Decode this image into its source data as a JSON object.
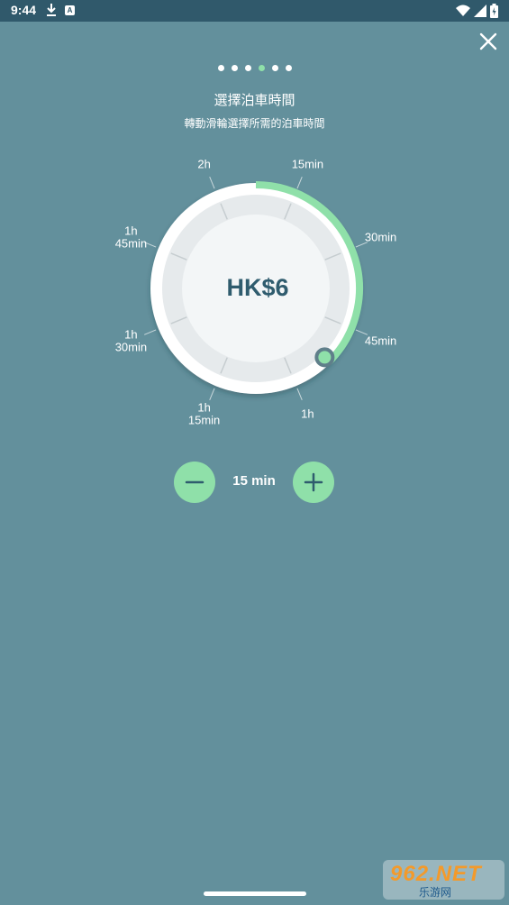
{
  "status_bar": {
    "time": "9:44",
    "a_badge": "A"
  },
  "icons": {
    "download": "download-icon",
    "a_badge": "a-badge-icon",
    "wifi": "wifi-icon",
    "signal": "signal-icon",
    "battery": "battery-icon",
    "close": "close-icon",
    "minus": "minus-icon",
    "plus": "plus-icon"
  },
  "pager": {
    "count": 6,
    "active_index": 3
  },
  "header": {
    "title": "選擇泊車時間",
    "subtitle": "轉動滑輪選擇所需的泊車時間"
  },
  "dial": {
    "labels": [
      {
        "lines": [
          "15min"
        ]
      },
      {
        "lines": [
          "30min"
        ]
      },
      {
        "lines": [
          "45min"
        ]
      },
      {
        "lines": [
          "1h"
        ]
      },
      {
        "lines": [
          "1h",
          "15min"
        ]
      },
      {
        "lines": [
          "1h",
          "30min"
        ]
      },
      {
        "lines": [
          "1h",
          "45min"
        ]
      },
      {
        "lines": [
          "2h"
        ]
      }
    ],
    "selected_fraction": 0.375,
    "price": "HK$6"
  },
  "stepper": {
    "value": "15 min"
  },
  "watermark": {
    "main": "962.NET",
    "sub": "乐游网"
  },
  "colors": {
    "background": "#63909c",
    "status_bar": "#30596b",
    "accent_green": "#8fe0a9",
    "price_text": "#2f5c6e",
    "dial_face": "#f3f6f7"
  }
}
